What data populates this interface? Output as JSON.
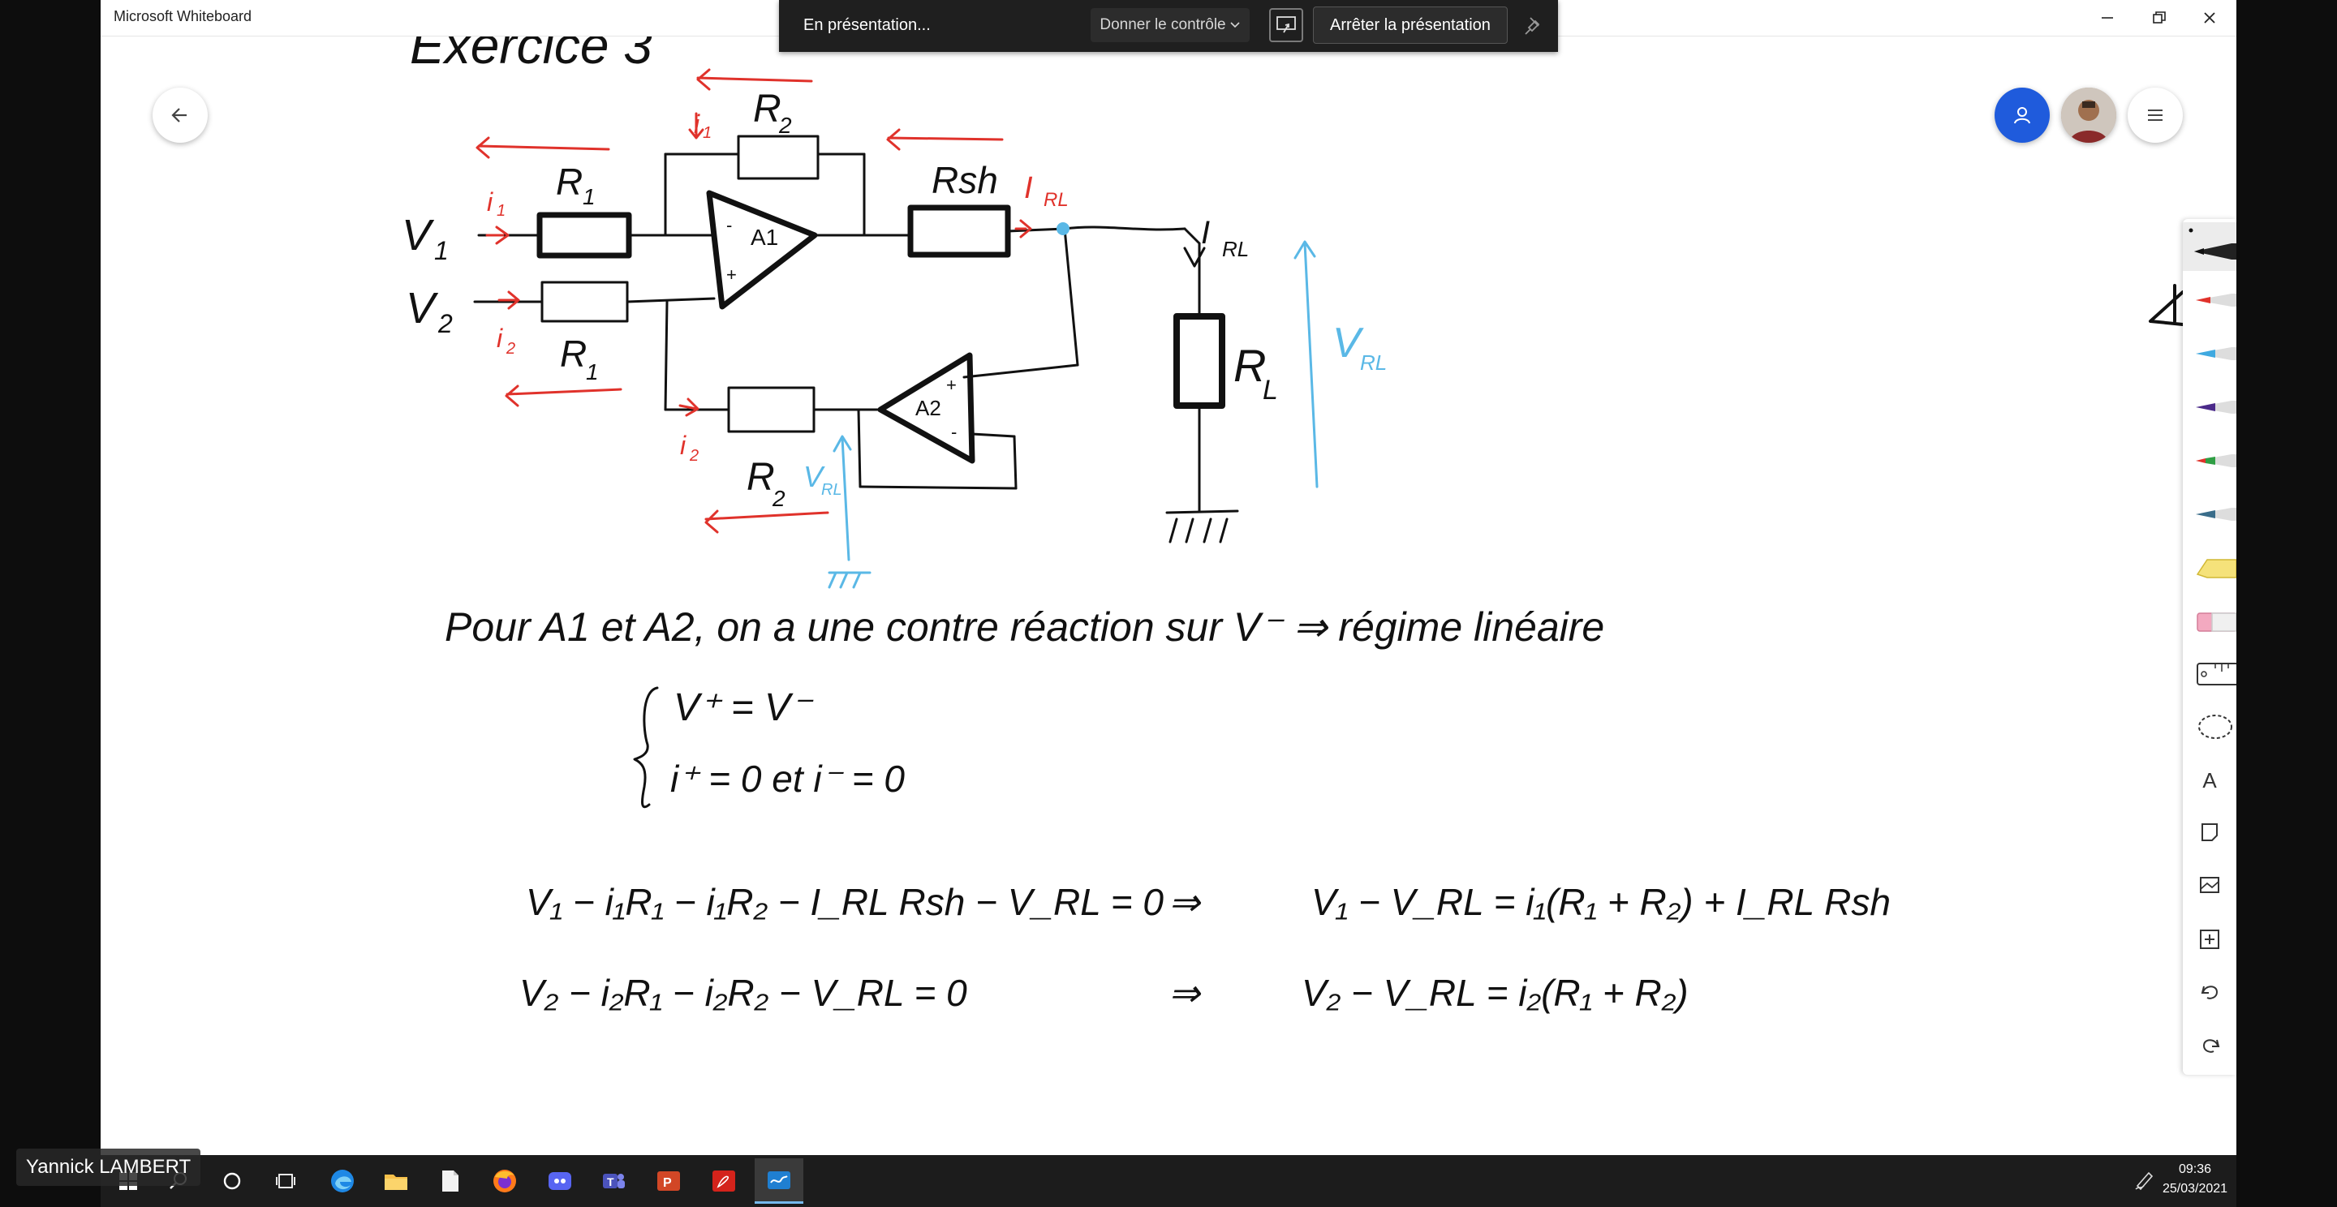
{
  "app": {
    "title": "Microsoft Whiteboard"
  },
  "presentation_bar": {
    "status": "En présentation...",
    "give_control": "Donner le contrôle",
    "stop": "Arrêter la présentation"
  },
  "presenter": {
    "name": "Yannick LAMBERT"
  },
  "board": {
    "title_partial": "Exercice 3",
    "circuit": {
      "input1": "V",
      "input1_sub": "1",
      "input2": "V",
      "input2_sub": "2",
      "r1_top": "R",
      "r1_top_sub": "1",
      "r1_bottom": "R",
      "r1_bottom_sub": "1",
      "r2_top": "R",
      "r2_top_sub": "2",
      "r2_bottom": "R",
      "r2_bottom_sub": "2",
      "rsh": "Rsh",
      "rl": "R",
      "rl_sub": "L",
      "opamp1": "A1",
      "opamp2": "A2",
      "current_i1": "i",
      "current_i1_sub": "1",
      "current_i2": "i",
      "current_i2_sub": "2",
      "current_irl": "I",
      "current_irl_sub": "RL",
      "vrl": "V",
      "vrl_sub": "RL",
      "plus": "+",
      "minus": "-"
    },
    "statement": "Pour A1 et A2, on a une contre réaction sur V⁻ ⇒ régime linéaire",
    "system_line1": "V⁺ = V⁻",
    "system_line2": "i⁺ = 0 et i⁻ = 0",
    "eq1_left": "V₁ − i₁R₁ − i₁R₂ − I_RL Rsh − V_RL = 0",
    "eq1_arrow": "⇒",
    "eq1_right": "V₁ − V_RL = i₁(R₁ + R₂) + I_RL Rsh",
    "eq2_left": "V₂ − i₂R₁ − i₂R₂ − V_RL = 0",
    "eq2_arrow": "⇒",
    "eq2_right": "V₂ − V_RL = i₂(R₁ + R₂)"
  },
  "toolbar": {
    "tools": [
      "pen-black",
      "pen-red",
      "pen-blue",
      "pen-purple",
      "pen-green",
      "pen-teal",
      "highlighter",
      "eraser",
      "ruler",
      "lasso",
      "text",
      "sticky-note",
      "image",
      "add",
      "undo",
      "redo"
    ],
    "text_tool_label": "A"
  },
  "colors": {
    "ink": "#111111",
    "red_ink": "#e0322b",
    "blue_ink": "#5ab8e6",
    "accent": "#1f5bdc"
  },
  "taskbar": {
    "time": "09:36",
    "date": "25/03/2021",
    "apps": [
      "start",
      "search",
      "cortana",
      "task-view",
      "edge",
      "file-explorer",
      "notepad",
      "firefox",
      "discord",
      "teams",
      "powerpoint",
      "acrobat",
      "whiteboard"
    ]
  }
}
